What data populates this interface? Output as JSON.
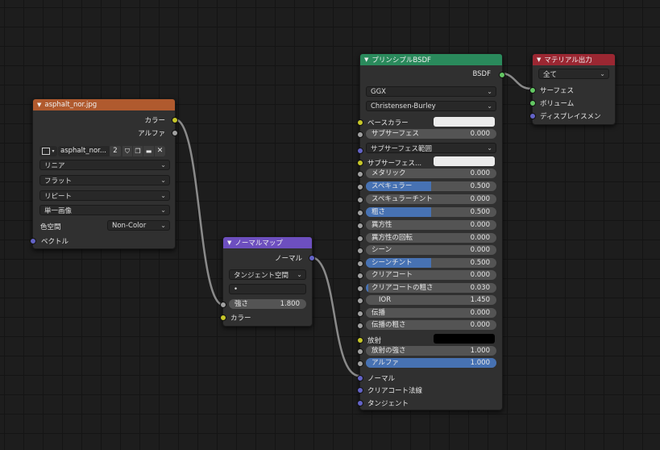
{
  "colors": {
    "texture_header": "#b05a2e",
    "normalmap_header": "#6d4fbf",
    "bsdf_header": "#2a8a5c",
    "output_header": "#9b2732",
    "slider_fill": "#4772b3"
  },
  "image_texture": {
    "title": "asphalt_nor.jpg",
    "out_color": "カラー",
    "out_alpha": "アルファ",
    "image_name": "asphalt_nor...",
    "users": "2",
    "interpolation": "リニア",
    "projection": "フラット",
    "extension": "リピート",
    "source": "単一画像",
    "colorspace_label": "色空間",
    "colorspace_value": "Non-Color",
    "in_vector": "ベクトル"
  },
  "normal_map": {
    "title": "ノーマルマップ",
    "out_normal": "ノーマル",
    "space": "タンジェント空間",
    "uv_value": "•",
    "strength_label": "強さ",
    "strength_value": "1.800",
    "in_color": "カラー"
  },
  "bsdf": {
    "title": "プリンシプルBSDF",
    "out_bsdf": "BSDF",
    "distribution": "GGX",
    "subsurface_method": "Christensen-Burley",
    "base_color": "ベースカラー",
    "subsurface": {
      "label": "サブサーフェス",
      "value": "0.000",
      "fill": 0
    },
    "subsurface_radius": "サブサーフェス範囲",
    "subsurface_color": "サブサーフェス...",
    "metallic": {
      "label": "メタリック",
      "value": "0.000",
      "fill": 0
    },
    "specular": {
      "label": "スペキュラー",
      "value": "0.500",
      "fill": 0.5
    },
    "specular_tint": {
      "label": "スペキュラーチント",
      "value": "0.000",
      "fill": 0
    },
    "roughness": {
      "label": "粗さ",
      "value": "0.500",
      "fill": 0.5
    },
    "anisotropic": {
      "label": "異方性",
      "value": "0.000",
      "fill": 0
    },
    "anisotropic_rotation": {
      "label": "異方性の回転",
      "value": "0.000",
      "fill": 0
    },
    "sheen": {
      "label": "シーン",
      "value": "0.000",
      "fill": 0
    },
    "sheen_tint": {
      "label": "シーンチント",
      "value": "0.500",
      "fill": 0.5
    },
    "clearcoat": {
      "label": "クリアコート",
      "value": "0.000",
      "fill": 0
    },
    "clearcoat_roughness": {
      "label": "クリアコートの粗さ",
      "value": "0.030",
      "fill": 0.03
    },
    "ior": {
      "label": "IOR",
      "value": "1.450",
      "fill": 0
    },
    "transmission": {
      "label": "伝播",
      "value": "0.000",
      "fill": 0
    },
    "transmission_roughness": {
      "label": "伝播の粗さ",
      "value": "0.000",
      "fill": 0
    },
    "emission": "放射",
    "emission_strength": {
      "label": "放射の強さ",
      "value": "1.000",
      "fill": 0
    },
    "alpha": {
      "label": "アルファ",
      "value": "1.000",
      "fill": 1
    },
    "in_normal": "ノーマル",
    "in_clearcoat_normal": "クリアコート法線",
    "in_tangent": "タンジェント"
  },
  "output": {
    "title": "マテリアル出力",
    "target": "全て",
    "in_surface": "サーフェス",
    "in_volume": "ボリューム",
    "in_displacement": "ディスプレイスメン"
  }
}
